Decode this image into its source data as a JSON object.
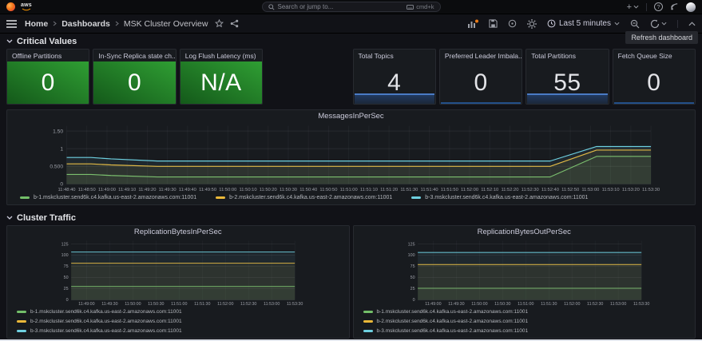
{
  "app": {
    "aws_logo_text": "aws"
  },
  "icons": {
    "plus": "+",
    "question": "?"
  },
  "topnav": {
    "search_placeholder": "Search or jump to...",
    "shortcut_label": "cmd+k"
  },
  "breadcrumb": {
    "items": [
      "Home",
      "Dashboards",
      "MSK Cluster Overview"
    ]
  },
  "toolbar": {
    "time_range_label": "Last 5 minutes",
    "refresh_tooltip": "Refresh dashboard"
  },
  "sections": {
    "critical_values": "Critical Values",
    "cluster_traffic": "Cluster Traffic"
  },
  "stats": [
    {
      "title": "Offline Partitions",
      "value": "0",
      "variant": "green",
      "spark": "none"
    },
    {
      "title": "In-Sync Replica state ch...",
      "value": "0",
      "variant": "green",
      "spark": "none"
    },
    {
      "title": "Log Flush Latency (ms)",
      "value": "N/A",
      "variant": "green",
      "spark": "none"
    },
    {
      "title": "Total Topics",
      "value": "4",
      "variant": "dark",
      "spark": "area"
    },
    {
      "title": "Preferred Leader Imbala...",
      "value": "0",
      "variant": "dark",
      "spark": "line"
    },
    {
      "title": "Total Partitions",
      "value": "55",
      "variant": "dark",
      "spark": "area"
    },
    {
      "title": "Fetch Queue Size",
      "value": "0",
      "variant": "dark",
      "spark": "line"
    }
  ],
  "chart_data": [
    {
      "type": "line",
      "title": "MessagesInPerSec",
      "xlabel": "",
      "ylabel": "",
      "ylim": [
        0,
        1.65
      ],
      "y_ticks": [
        {
          "value": 0,
          "label": "0"
        },
        {
          "value": 0.5,
          "label": "0.500"
        },
        {
          "value": 1,
          "label": "1"
        },
        {
          "value": 1.5,
          "label": "1.50"
        }
      ],
      "xlim": [
        0,
        290
      ],
      "x_tick_start": 0,
      "x_tick_step": 10,
      "x_tick_labels": [
        "11:48:40",
        "11:48:50",
        "11:49:00",
        "11:49:10",
        "11:49:20",
        "11:49:30",
        "11:49:40",
        "11:49:50",
        "11:50:00",
        "11:50:10",
        "11:50:20",
        "11:50:30",
        "11:50:40",
        "11:50:50",
        "11:51:00",
        "11:51:10",
        "11:51:20",
        "11:51:30",
        "11:51:40",
        "11:51:50",
        "11:52:00",
        "11:52:10",
        "11:52:20",
        "11:52:30",
        "11:52:40",
        "11:52:50",
        "11:53:00",
        "11:53:10",
        "11:53:20",
        "11:53:30"
      ],
      "x_label_size": 6.5,
      "margin_left": 30,
      "legend_position": "bottom",
      "grid": true,
      "series": [
        {
          "name": "b-1.mskcluster.send6k.c4.kafka.us-east-2.amazonaws.com:11001",
          "color": "#73BF69",
          "points": [
            [
              0,
              0.27
            ],
            [
              12,
              0.27
            ],
            [
              22,
              0.24
            ],
            [
              45,
              0.2
            ],
            [
              240,
              0.2
            ],
            [
              263,
              0.78
            ],
            [
              290,
              0.78
            ]
          ]
        },
        {
          "name": "b-2.mskcluster.send6k.c4.kafka.us-east-2.amazonaws.com:11001",
          "color": "#EAB839",
          "points": [
            [
              0,
              0.57
            ],
            [
              12,
              0.57
            ],
            [
              22,
              0.54
            ],
            [
              45,
              0.5
            ],
            [
              240,
              0.5
            ],
            [
              263,
              0.96
            ],
            [
              290,
              0.96
            ]
          ]
        },
        {
          "name": "b-3.mskcluster.send6k.c4.kafka.us-east-2.amazonaws.com:11001",
          "color": "#6ED0E0",
          "points": [
            [
              0,
              0.75
            ],
            [
              12,
              0.75
            ],
            [
              22,
              0.71
            ],
            [
              45,
              0.65
            ],
            [
              240,
              0.65
            ],
            [
              263,
              1.06
            ],
            [
              290,
              1.06
            ]
          ]
        }
      ]
    },
    {
      "type": "line",
      "title": "ReplicationBytesInPerSec",
      "xlabel": "",
      "ylabel": "",
      "ylim": [
        0,
        132
      ],
      "y_ticks": [
        {
          "value": 0,
          "label": "0"
        },
        {
          "value": 25,
          "label": "25"
        },
        {
          "value": 50,
          "label": "50"
        },
        {
          "value": 75,
          "label": "75"
        },
        {
          "value": 100,
          "label": "100"
        },
        {
          "value": 125,
          "label": "125"
        }
      ],
      "xlim": [
        0,
        290
      ],
      "x_tick_start": 20,
      "x_tick_step": 30,
      "x_tick_labels": [
        "11:49:00",
        "11:49:30",
        "11:50:00",
        "11:50:30",
        "11:51:00",
        "11:51:30",
        "11:52:00",
        "11:52:30",
        "11:53:00",
        "11:53:30"
      ],
      "x_label_size": 7.5,
      "margin_left": 26,
      "legend_position": "bottom",
      "grid": true,
      "series": [
        {
          "name": "b-1.mskcluster.send6k.c4.kafka.us-east-2.amazonaws.com:11001",
          "color": "#73BF69",
          "points": [
            [
              0,
              30
            ],
            [
              290,
              30
            ]
          ]
        },
        {
          "name": "b-2.mskcluster.send6k.c4.kafka.us-east-2.amazonaws.com:11001",
          "color": "#EAB839",
          "points": [
            [
              0,
              82
            ],
            [
              290,
              82
            ]
          ]
        },
        {
          "name": "b-3.mskcluster.send6k.c4.kafka.us-east-2.amazonaws.com:11001",
          "color": "#6ED0E0",
          "points": [
            [
              0,
              107
            ],
            [
              290,
              107
            ]
          ]
        }
      ]
    },
    {
      "type": "line",
      "title": "ReplicationBytesOutPerSec",
      "xlabel": "",
      "ylabel": "",
      "ylim": [
        0,
        132
      ],
      "y_ticks": [
        {
          "value": 0,
          "label": "0"
        },
        {
          "value": 25,
          "label": "25"
        },
        {
          "value": 50,
          "label": "50"
        },
        {
          "value": 75,
          "label": "75"
        },
        {
          "value": 100,
          "label": "100"
        },
        {
          "value": 125,
          "label": "125"
        }
      ],
      "xlim": [
        0,
        290
      ],
      "x_tick_start": 20,
      "x_tick_step": 30,
      "x_tick_labels": [
        "11:49:00",
        "11:49:30",
        "11:50:00",
        "11:50:30",
        "11:51:00",
        "11:51:30",
        "11:52:00",
        "11:52:30",
        "11:53:00",
        "11:53:30"
      ],
      "x_label_size": 7.5,
      "margin_left": 26,
      "legend_position": "bottom",
      "grid": true,
      "series": [
        {
          "name": "b-1.mskcluster.send6k.c4.kafka.us-east-2.amazonaws.com:11001",
          "color": "#73BF69",
          "points": [
            [
              0,
              26
            ],
            [
              290,
              26
            ]
          ]
        },
        {
          "name": "b-2.mskcluster.send6k.c4.kafka.us-east-2.amazonaws.com:11001",
          "color": "#EAB839",
          "points": [
            [
              0,
              79
            ],
            [
              290,
              79
            ]
          ]
        },
        {
          "name": "b-3.mskcluster.send6k.c4.kafka.us-east-2.amazonaws.com:11001",
          "color": "#6ED0E0",
          "points": [
            [
              0,
              106
            ],
            [
              290,
              106
            ]
          ]
        }
      ]
    }
  ],
  "colors": {
    "green": "#73BF69",
    "yellow": "#EAB839",
    "blue": "#6ED0E0",
    "stat_green_from": "#14591a",
    "stat_green_to": "#2f9e33",
    "spark_line": "#4a7bc4"
  }
}
